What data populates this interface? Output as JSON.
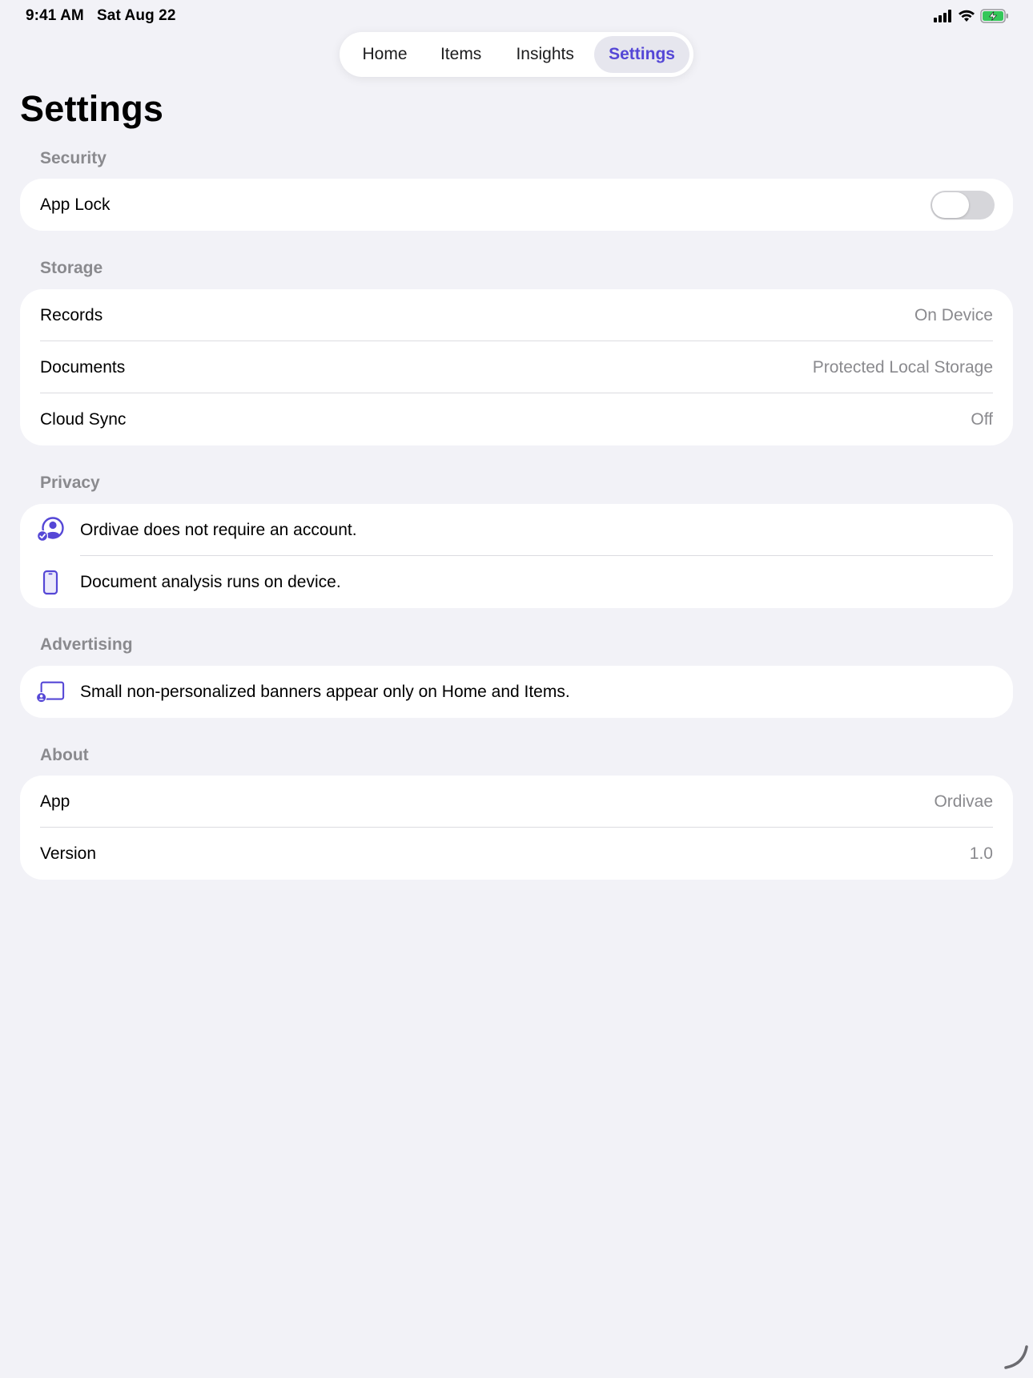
{
  "status_bar": {
    "time": "9:41 AM",
    "date": "Sat Aug 22"
  },
  "tabs": [
    {
      "label": "Home",
      "selected": false
    },
    {
      "label": "Items",
      "selected": false
    },
    {
      "label": "Insights",
      "selected": false
    },
    {
      "label": "Settings",
      "selected": true
    }
  ],
  "page_title": "Settings",
  "sections": {
    "security": {
      "header": "Security",
      "app_lock": {
        "label": "App Lock",
        "enabled": false
      }
    },
    "storage": {
      "header": "Storage",
      "rows": [
        {
          "label": "Records",
          "value": "On Device"
        },
        {
          "label": "Documents",
          "value": "Protected Local Storage"
        },
        {
          "label": "Cloud Sync",
          "value": "Off"
        }
      ]
    },
    "privacy": {
      "header": "Privacy",
      "rows": [
        {
          "icon": "person-checkmark-icon",
          "text": "Ordivae does not require an account."
        },
        {
          "icon": "iphone-icon",
          "text": "Document analysis runs on device."
        }
      ]
    },
    "advertising": {
      "header": "Advertising",
      "rows": [
        {
          "icon": "display-person-icon",
          "text": "Small non-personalized banners appear only on Home and Items."
        }
      ]
    },
    "about": {
      "header": "About",
      "rows": [
        {
          "label": "App",
          "value": "Ordivae"
        },
        {
          "label": "Version",
          "value": "1.0"
        }
      ]
    }
  },
  "colors": {
    "accent": "#5547d6",
    "background": "#f2f2f7",
    "secondary_text": "#8a8a8e",
    "battery_green": "#34c759"
  }
}
